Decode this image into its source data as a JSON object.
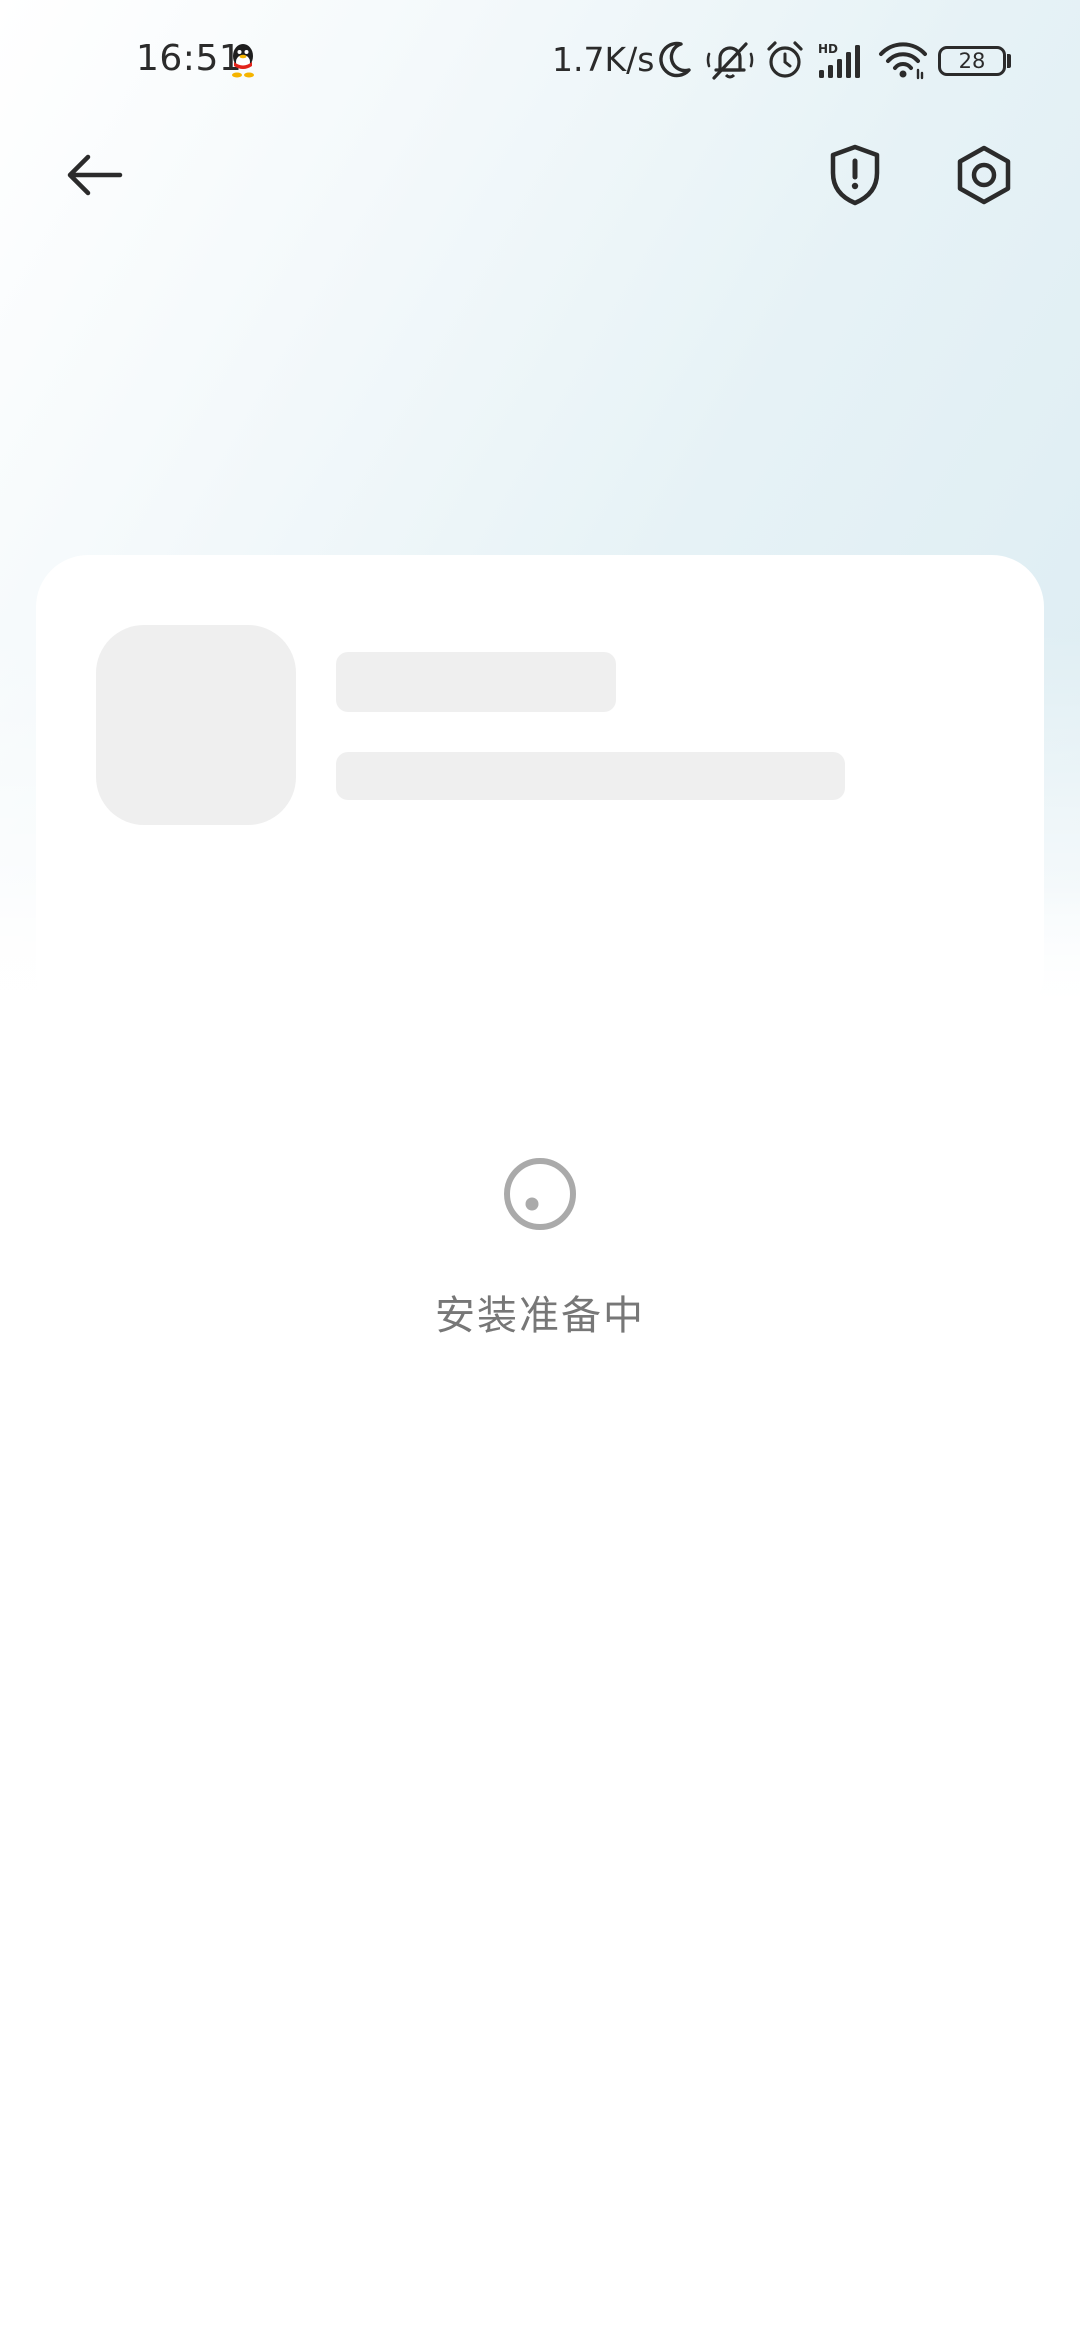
{
  "status_bar": {
    "time": "16:51",
    "network_speed": "1.7K/s",
    "signal_label": "HD",
    "battery_level": "28",
    "icons": [
      "qq-icon",
      "moon-icon",
      "bell-off-icon",
      "alarm-icon",
      "signal-icon",
      "wifi-icon",
      "battery-icon"
    ]
  },
  "header": {
    "icons": [
      "back-arrow-icon",
      "shield-alert-icon",
      "settings-gear-icon"
    ]
  },
  "loading": {
    "text": "安装准备中"
  },
  "colors": {
    "text_dark": "#2b2b2b",
    "loading_text": "#777777",
    "spinner": "#aaaaaa",
    "skeleton": "#efefef",
    "gradient_tint": "#dcecf2"
  }
}
